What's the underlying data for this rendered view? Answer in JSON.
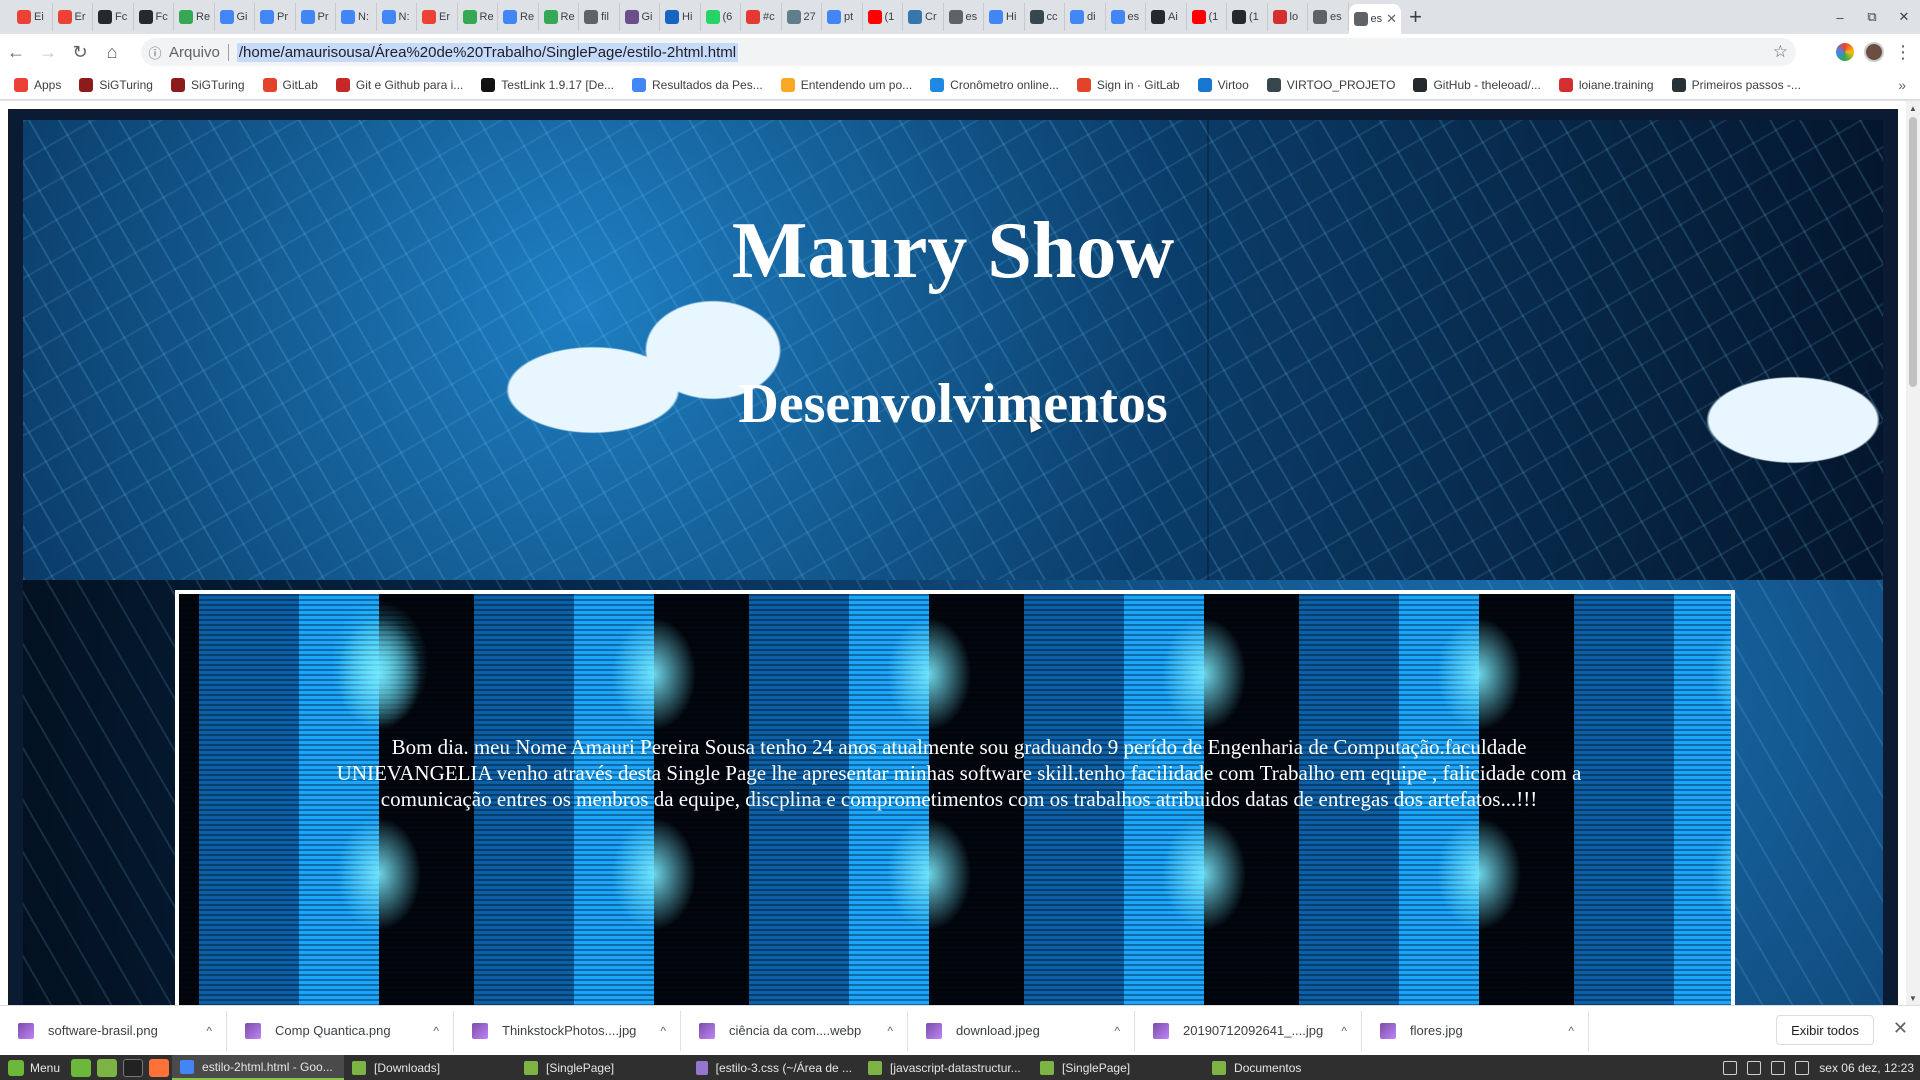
{
  "browser": {
    "tabs": [
      {
        "label": "Ei",
        "icon": "gmail-icon",
        "color": "#ea4335"
      },
      {
        "label": "Er",
        "icon": "gmail-icon",
        "color": "#ea4335"
      },
      {
        "label": "Fc",
        "icon": "github-icon",
        "color": "#24292e"
      },
      {
        "label": "Fc",
        "icon": "github-icon",
        "color": "#24292e"
      },
      {
        "label": "Re",
        "icon": "drive-icon",
        "color": "#34a853"
      },
      {
        "label": "Gi",
        "icon": "google-icon",
        "color": "#4285f4"
      },
      {
        "label": "Pr",
        "icon": "docs-icon",
        "color": "#4285f4"
      },
      {
        "label": "Pr",
        "icon": "docs-icon",
        "color": "#4285f4"
      },
      {
        "label": "N:",
        "icon": "google-icon",
        "color": "#4285f4"
      },
      {
        "label": "N:",
        "icon": "google-icon",
        "color": "#4285f4"
      },
      {
        "label": "Er",
        "icon": "gmail-icon",
        "color": "#ea4335"
      },
      {
        "label": "Re",
        "icon": "drive-icon",
        "color": "#34a853"
      },
      {
        "label": "Re",
        "icon": "docs-icon",
        "color": "#4285f4"
      },
      {
        "label": "Re",
        "icon": "drive-icon",
        "color": "#34a853"
      },
      {
        "label": "fil",
        "icon": "globe-icon",
        "color": "#5f6368"
      },
      {
        "label": "Gi",
        "icon": "app-icon",
        "color": "#6b4f8c"
      },
      {
        "label": "Hi",
        "icon": "app-icon",
        "color": "#1565c0"
      },
      {
        "label": "(6",
        "icon": "whatsapp-icon",
        "color": "#25d366"
      },
      {
        "label": "#c",
        "icon": "app-icon",
        "color": "#e53935"
      },
      {
        "label": "27",
        "icon": "app-icon",
        "color": "#607d8b"
      },
      {
        "label": "pt",
        "icon": "google-icon",
        "color": "#4285f4"
      },
      {
        "label": "(1",
        "icon": "youtube-icon",
        "color": "#ff0000"
      },
      {
        "label": "Cr",
        "icon": "python-icon",
        "color": "#3776ab"
      },
      {
        "label": "es",
        "icon": "globe-icon",
        "color": "#5f6368"
      },
      {
        "label": "Hi",
        "icon": "google-icon",
        "color": "#4285f4"
      },
      {
        "label": "cc",
        "icon": "app-icon",
        "color": "#37474f"
      },
      {
        "label": "di",
        "icon": "google-icon",
        "color": "#4285f4"
      },
      {
        "label": "es",
        "icon": "google-icon",
        "color": "#4285f4"
      },
      {
        "label": "Ai",
        "icon": "github-icon",
        "color": "#24292e"
      },
      {
        "label": "(1",
        "icon": "youtube-icon",
        "color": "#ff0000"
      },
      {
        "label": "(1",
        "icon": "github-icon",
        "color": "#24292e"
      },
      {
        "label": "lo",
        "icon": "app-icon",
        "color": "#d32f2f"
      },
      {
        "label": "es",
        "icon": "globe-icon",
        "color": "#5f6368"
      }
    ],
    "active_tab": {
      "label": "es",
      "icon": "globe-icon"
    },
    "new_tab": "+",
    "window_controls": [
      "–",
      "⧉",
      "✕"
    ],
    "address": {
      "scheme": "Arquivo",
      "url": "/home/amaurisousa/%C3%81rea%20de%20Trabalho/SinglePage/estilo-2html.html",
      "url_display": "/home/amaurisousa/Área%20de%20Trabalho/SinglePage/estilo-2html.html"
    },
    "bookmarks": [
      {
        "label": "Apps",
        "icon": "apps-grid-icon",
        "color": "#ea4335"
      },
      {
        "label": "SiGTuring",
        "icon": "sigturing-icon",
        "color": "#8e1b1b"
      },
      {
        "label": "SiGTuring",
        "icon": "sigturing-icon",
        "color": "#8e1b1b"
      },
      {
        "label": "GitLab",
        "icon": "gitlab-icon",
        "color": "#e24329"
      },
      {
        "label": "Git e Github para i...",
        "icon": "app-icon",
        "color": "#c62828"
      },
      {
        "label": "TestLink 1.9.17 [De...",
        "icon": "testlink-icon",
        "color": "#111111"
      },
      {
        "label": "Resultados da Pes...",
        "icon": "google-icon",
        "color": "#4285f4"
      },
      {
        "label": "Entendendo um po...",
        "icon": "lightbulb-icon",
        "color": "#f9a825"
      },
      {
        "label": "Cronômetro online...",
        "icon": "stopwatch-icon",
        "color": "#1e88e5"
      },
      {
        "label": "Sign in · GitLab",
        "icon": "gitlab-icon",
        "color": "#e24329"
      },
      {
        "label": "Virtoo",
        "icon": "virtoo-icon",
        "color": "#1976d2"
      },
      {
        "label": "VIRTOO_PROJETO",
        "icon": "globe-icon",
        "color": "#37474f"
      },
      {
        "label": "GitHub - theleoad/...",
        "icon": "github-icon",
        "color": "#24292e"
      },
      {
        "label": "loiane.training",
        "icon": "app-icon",
        "color": "#d32f2f"
      },
      {
        "label": "Primeiros passos -...",
        "icon": "app-icon",
        "color": "#263238"
      }
    ]
  },
  "page": {
    "title": "Maury Show",
    "subtitle": "Desenvolvimentos",
    "about": "Bom dia. meu Nome Amauri Pereira Sousa tenho 24 anos atualmente sou graduando 9 perído de Engenharia de Computação.faculdade UNIEVANGELIA venho através desta Single Page lhe apresentar minhas software skill.tenho facilidade com Trabalho em equipe , falicidade com a comunicação entres os menbros da equipe, discplina e comprometimentos com os trabalhos atribuidos datas de entregas dos artefatos...!!!"
  },
  "downloads": {
    "items": [
      {
        "name": "software-brasil.png"
      },
      {
        "name": "Comp Quantica.png"
      },
      {
        "name": "ThinkstockPhotos....jpg"
      },
      {
        "name": "ciência da com....webp"
      },
      {
        "name": "download.jpeg"
      },
      {
        "name": "20190712092641_....jpg"
      },
      {
        "name": "flores.jpg"
      }
    ],
    "show_all": "Exibir todos"
  },
  "taskbar": {
    "menu_label": "Menu",
    "tasks": [
      {
        "label": "estilo-2html.html - Goo...",
        "active": true,
        "color": "#4285f4"
      },
      {
        "label": "[Downloads]",
        "active": false,
        "color": "#7cb342"
      },
      {
        "label": "[SinglePage]",
        "active": false,
        "color": "#7cb342"
      },
      {
        "label": "[estilo-3.css (~/Área de ...",
        "active": false,
        "color": "#9575cd"
      },
      {
        "label": "[javascript-datastructur...",
        "active": false,
        "color": "#7cb342"
      },
      {
        "label": "[SinglePage]",
        "active": false,
        "color": "#7cb342"
      },
      {
        "label": "Documentos",
        "active": false,
        "color": "#7cb342"
      }
    ],
    "clock": "sex 06 dez, 12:23"
  }
}
